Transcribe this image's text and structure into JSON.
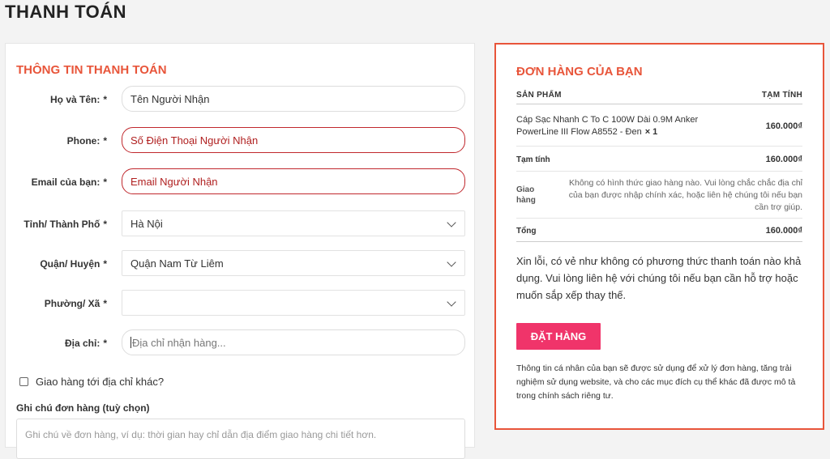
{
  "page": {
    "title": "THANH TOÁN"
  },
  "billing": {
    "section_title": "THÔNG TIN THANH TOÁN",
    "fields": [
      {
        "label": "Họ và Tên:",
        "required": "*",
        "value": "Tên Người Nhận"
      },
      {
        "label": "Phone:",
        "required": "*",
        "value": "Số Điện Thoại Người Nhận"
      },
      {
        "label": "Email của bạn:",
        "required": "*",
        "value": "Email Người Nhận"
      },
      {
        "label": "Tỉnh/ Thành Phố",
        "required": "*",
        "value": "Hà Nội"
      },
      {
        "label": "Quận/ Huyện",
        "required": "*",
        "value": "Quận Nam Từ Liêm"
      },
      {
        "label": "Phường/ Xã",
        "required": "*",
        "value": ""
      },
      {
        "label": "Địa chỉ:",
        "required": "*",
        "placeholder": "Địa chỉ nhận hàng..."
      }
    ],
    "ship_other_label": "Giao hàng tới địa chỉ khác?",
    "note_label": "Ghi chú đơn hàng (tuỳ chọn)",
    "note_placeholder": "Ghi chú về đơn hàng, ví dụ: thời gian hay chỉ dẫn địa điểm giao hàng chi tiết hơn."
  },
  "order": {
    "title": "ĐƠN HÀNG CỦA BẠN",
    "col_product": "SẢN PHẨM",
    "col_subtotal": "TẠM TÍNH",
    "item": {
      "name": "Cáp Sạc Nhanh C To C 100W Dài 0.9M Anker PowerLine III Flow A8552 - Đen",
      "qty": "× 1",
      "price": "160.000₫"
    },
    "subtotal_label": "Tạm tính",
    "subtotal_value": "160.000₫",
    "shipping_label": "Giao hàng",
    "shipping_note": "Không có hình thức giao hàng nào. Vui lòng chắc chắc địa chỉ của bạn được nhập chính xác, hoặc liên hệ chúng tôi nếu bạn cần trợ giúp.",
    "total_label": "Tổng",
    "total_value": "160.000₫",
    "no_payment_msg": "Xin lỗi, có vẻ như không có phương thức thanh toán nào khả dụng. Vui lòng liên hệ với chúng tôi nếu bạn cần hỗ trợ hoặc muốn sắp xếp thay thế.",
    "place_order_label": "ĐẶT HÀNG",
    "privacy_text": "Thông tin cá nhân của bạn sẽ được sử dụng để xử lý đơn hàng, tăng trải nghiệm sử dụng website, và cho các mục đích cụ thể khác đã được mô tả trong chính sách riêng tư."
  },
  "colors": {
    "accent": "#e8553a",
    "button": "#f0346a",
    "error_border": "#c0282d"
  }
}
